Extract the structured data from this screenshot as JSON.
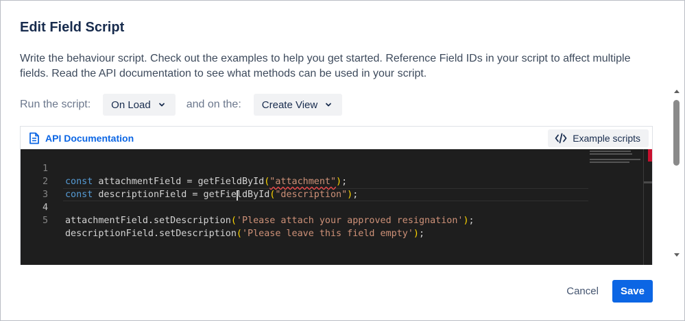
{
  "dialog": {
    "title": "Edit Field Script",
    "description": "Write the behaviour script. Check out the examples to help you get started. Reference Field IDs in your script to affect multiple fields. Read the API documentation to see what methods can be used in your script."
  },
  "run": {
    "label": "Run the script:",
    "trigger_value": "On Load",
    "and_label": "and on the:",
    "view_value": "Create View"
  },
  "editor": {
    "api_link": "API Documentation",
    "examples_button": "Example scripts",
    "line_numbers": [
      "1",
      "2",
      "3",
      "4",
      "5"
    ],
    "lines": {
      "l1": {
        "kw": "const",
        "var": " attachmentField = getFieldById",
        "open": "(",
        "str": "\"attachment\"",
        "close": ")",
        "end": ";"
      },
      "l2": {
        "kw": "const",
        "var": " descriptionField = getFieldById",
        "open": "(",
        "str": "\"description\"",
        "close": ")",
        "end": ";"
      },
      "l4": {
        "call": "attachmentField.setDescription",
        "open": "(",
        "str": "'Please attach your approved resignation'",
        "close": ")",
        "end": ";"
      },
      "l5": {
        "call": "descriptionField.setDescription",
        "open": "(",
        "str": "'Please leave this field empty'",
        "close": ")",
        "end": ";"
      }
    }
  },
  "footer": {
    "cancel_label": "Cancel",
    "save_label": "Save"
  },
  "colors": {
    "primary": "#0c66e4",
    "editor_bg": "#1e1e1e",
    "keyword": "#569cd6",
    "string": "#ce9178"
  },
  "icons": {
    "api": "document-icon",
    "examples": "code-icon",
    "select": "chevron-down-icon"
  }
}
